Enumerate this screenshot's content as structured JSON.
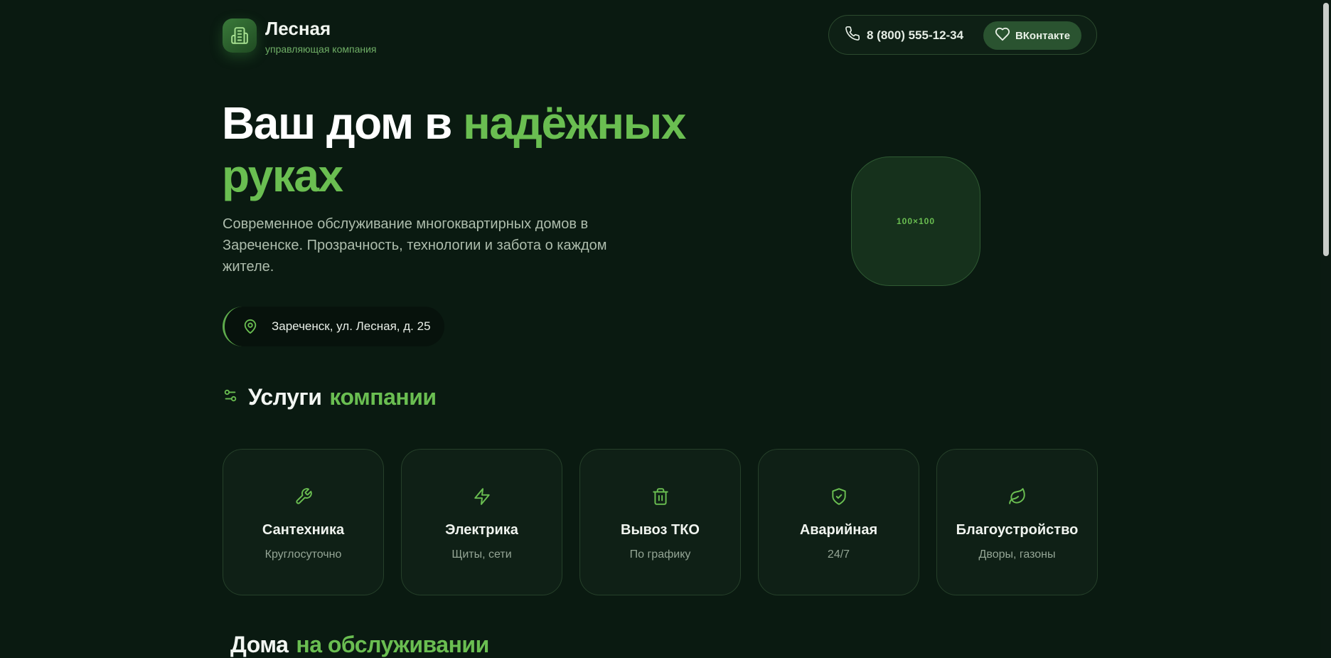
{
  "header": {
    "brand_name": "Лесная",
    "brand_subtitle": "управляющая компания",
    "phone": "8 (800) 555-12-34",
    "vk_label": "ВКонтакте"
  },
  "hero": {
    "title_plain": "Ваш дом в",
    "title_accent": "надёжных руках",
    "description": "Современное обслуживание многоквартирных домов в Зареченске. Прозрачность, технологии и забота о каждом жителе.",
    "address": "Зареченск, ул. Лесная, д. 25",
    "image_placeholder": "100×100"
  },
  "services": {
    "title_plain": "Услуги",
    "title_accent": "компании",
    "items": [
      {
        "title": "Сантехника",
        "subtitle": "Круглосуточно",
        "icon": "wrench-icon"
      },
      {
        "title": "Электрика",
        "subtitle": "Щиты, сети",
        "icon": "lightning-icon"
      },
      {
        "title": "Вывоз ТКО",
        "subtitle": "По графику",
        "icon": "trash-icon"
      },
      {
        "title": "Аварийная",
        "subtitle": "24/7",
        "icon": "shield-check-icon"
      },
      {
        "title": "Благоустройство",
        "subtitle": "Дворы, газоны",
        "icon": "leaf-icon"
      }
    ]
  },
  "houses": {
    "title_plain": "Дома",
    "title_accent": "на обслуживании"
  },
  "colors": {
    "background": "#0a1a11",
    "accent": "#6abe51",
    "card_bg": "#0f2016"
  }
}
